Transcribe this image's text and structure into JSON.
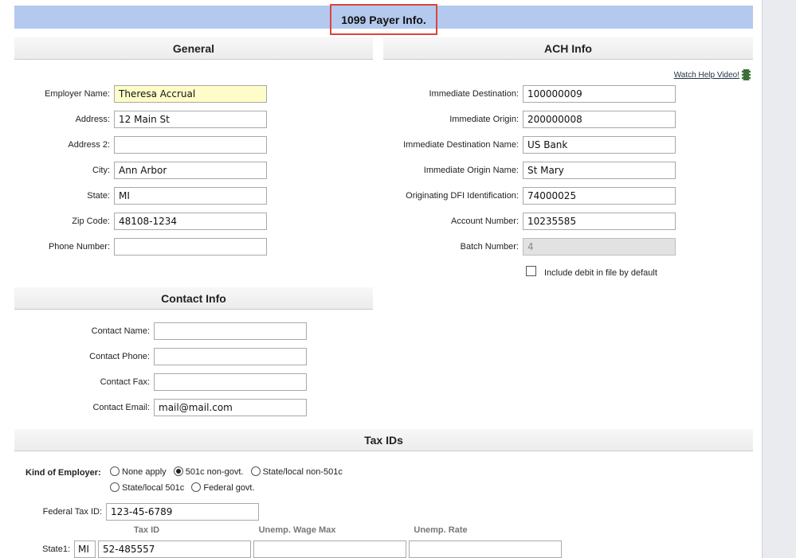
{
  "title": "1099 Payer Info.",
  "general": {
    "heading": "General",
    "fields": [
      {
        "label": "Employer Name:",
        "value": "Theresa Accrual"
      },
      {
        "label": "Address:",
        "value": "12 Main St"
      },
      {
        "label": "Address 2:",
        "value": ""
      },
      {
        "label": "City:",
        "value": "Ann Arbor"
      },
      {
        "label": "State:",
        "value": "MI"
      },
      {
        "label": "Zip Code:",
        "value": "48108-1234"
      },
      {
        "label": "Phone Number:",
        "value": ""
      }
    ]
  },
  "ach": {
    "heading": "ACH Info",
    "help_link": "Watch Help Video!",
    "help_icon": "film-icon",
    "fields": [
      {
        "label": "Immediate Destination:",
        "value": "100000009"
      },
      {
        "label": "Immediate Origin:",
        "value": "200000008"
      },
      {
        "label": "Immediate Destination Name:",
        "value": "US Bank"
      },
      {
        "label": "Immediate Origin Name:",
        "value": "St Mary"
      },
      {
        "label": "Originating DFI Identification:",
        "value": "74000025"
      },
      {
        "label": "Account Number:",
        "value": "10235585"
      },
      {
        "label": "Batch Number:",
        "value": "4"
      }
    ],
    "include_debit_label": "Include debit in file by default",
    "include_debit_checked": false
  },
  "contact": {
    "heading": "Contact Info",
    "fields": [
      {
        "label": "Contact Name:",
        "value": ""
      },
      {
        "label": "Contact Phone:",
        "value": ""
      },
      {
        "label": "Contact Fax:",
        "value": ""
      },
      {
        "label": "Contact Email:",
        "value": "mail@mail.com"
      }
    ]
  },
  "tax": {
    "heading": "Tax IDs",
    "kind_label": "Kind of Employer:",
    "kind_options": [
      "None apply",
      "501c non-govt.",
      "State/local non-501c",
      "State/local 501c",
      "Federal govt."
    ],
    "kind_selected": "501c non-govt.",
    "federal_label": "Federal Tax ID:",
    "federal_value": "123-45-6789",
    "columns": [
      "Tax ID",
      "Unemp. Wage Max",
      "Unemp. Rate"
    ],
    "states": [
      {
        "label": "State1:",
        "state": "MI",
        "tax_id": "52-485557",
        "wage_max": "",
        "rate": ""
      }
    ]
  }
}
